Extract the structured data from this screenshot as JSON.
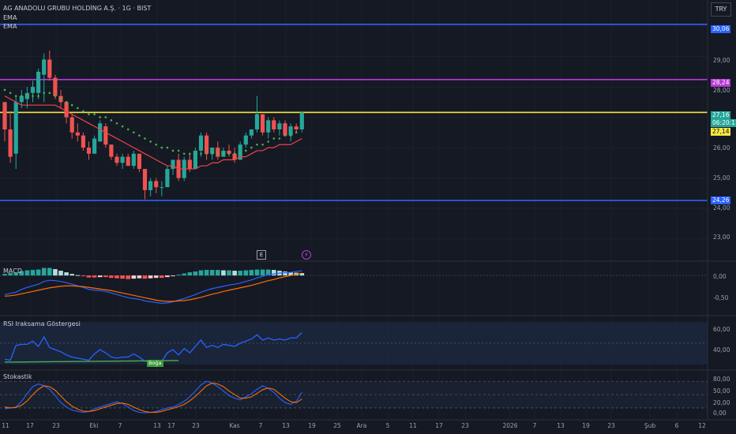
{
  "header": {
    "title": "AG ANADOLU GRUBU HOLDİNG A.Ş. · 1G · BIST",
    "indicators": [
      "EMA",
      "EMA"
    ],
    "currency": "TRY"
  },
  "price_axis": {
    "labels": [
      "30,06",
      "29,00",
      "28,24",
      "28,00",
      "27,16",
      "06:20:11",
      "27,14",
      "26,00",
      "25,00",
      "24,26",
      "24,00",
      "23,00"
    ]
  },
  "horizontal_lines": [
    {
      "price": 30.06,
      "label": "30,06",
      "color": "#2962ff"
    },
    {
      "price": 28.24,
      "label": "28,24",
      "color": "#b63ad6"
    },
    {
      "price": 27.16,
      "label": "27,16",
      "color": "#f5e642"
    },
    {
      "price": 24.26,
      "label": "24,26",
      "color": "#2962ff"
    }
  ],
  "last_price": {
    "value": "27,16",
    "countdown": "06:20:11",
    "ema": "27,14"
  },
  "event_markers": [
    "E",
    "⚡"
  ],
  "panes": {
    "macd": {
      "label": "MACD",
      "axis": [
        "0,00",
        "-0,50"
      ]
    },
    "rsi": {
      "label": "RSI Iraksama Göstergesi",
      "axis": [
        "60,00",
        "40,00"
      ],
      "badge": "Boğa"
    },
    "stoch": {
      "label": "Stokastik",
      "axis": [
        "80,00",
        "50,00",
        "20,00",
        "0,00"
      ]
    }
  },
  "time_axis": [
    "11",
    "17",
    "23",
    "Eki",
    "7",
    "13",
    "17",
    "23",
    "Kas",
    "7",
    "13",
    "19",
    "25",
    "Ara",
    "5",
    "11",
    "17",
    "23",
    "2026",
    "7",
    "13",
    "19",
    "23",
    "Şub",
    "6",
    "12"
  ],
  "chart_data": {
    "type": "candlestick",
    "ylim": [
      22.6,
      30.6
    ],
    "candles": [
      [
        27.5,
        27.5,
        26.2,
        26.6
      ],
      [
        26.6,
        27.2,
        25.5,
        25.7
      ],
      [
        25.8,
        27.7,
        25.3,
        27.5
      ],
      [
        27.5,
        27.9,
        27.3,
        27.7
      ],
      [
        27.6,
        28.0,
        27.3,
        27.8
      ],
      [
        27.8,
        28.2,
        27.5,
        28.0
      ],
      [
        27.8,
        28.6,
        27.6,
        28.5
      ],
      [
        28.4,
        29.1,
        27.5,
        28.9
      ],
      [
        28.9,
        29.2,
        28.2,
        28.3
      ],
      [
        28.3,
        28.4,
        27.6,
        27.7
      ],
      [
        27.7,
        27.9,
        27.3,
        27.5
      ],
      [
        27.5,
        27.5,
        26.8,
        27.0
      ],
      [
        27.0,
        27.1,
        26.3,
        26.5
      ],
      [
        26.5,
        26.8,
        26.2,
        26.4
      ],
      [
        26.4,
        26.5,
        25.9,
        26.0
      ],
      [
        26.0,
        26.2,
        25.6,
        25.8
      ],
      [
        25.8,
        26.4,
        25.8,
        26.3
      ],
      [
        26.2,
        26.9,
        26.2,
        26.8
      ],
      [
        26.7,
        26.8,
        26.0,
        26.1
      ],
      [
        26.1,
        26.1,
        25.6,
        25.7
      ],
      [
        25.7,
        25.8,
        25.4,
        25.5
      ],
      [
        25.5,
        25.8,
        25.3,
        25.7
      ],
      [
        25.7,
        25.8,
        25.4,
        25.4
      ],
      [
        25.4,
        25.9,
        25.3,
        25.8
      ],
      [
        25.8,
        25.8,
        25.2,
        25.3
      ],
      [
        25.3,
        25.3,
        24.3,
        24.6
      ],
      [
        24.6,
        25.0,
        24.4,
        24.9
      ],
      [
        24.9,
        25.0,
        24.5,
        24.7
      ],
      [
        24.7,
        24.9,
        24.4,
        24.7
      ],
      [
        24.7,
        25.4,
        24.7,
        25.3
      ],
      [
        25.3,
        25.6,
        25.1,
        25.6
      ],
      [
        25.6,
        25.8,
        24.9,
        25.0
      ],
      [
        25.0,
        25.7,
        24.9,
        25.6
      ],
      [
        25.6,
        25.8,
        25.2,
        25.3
      ],
      [
        25.3,
        26.0,
        25.3,
        25.9
      ],
      [
        25.9,
        26.5,
        25.7,
        26.4
      ],
      [
        26.4,
        26.5,
        25.6,
        25.8
      ],
      [
        25.8,
        26.0,
        25.6,
        26.0
      ],
      [
        26.0,
        26.2,
        25.6,
        25.7
      ],
      [
        25.7,
        26.0,
        25.7,
        25.9
      ],
      [
        25.9,
        26.1,
        25.7,
        25.8
      ],
      [
        25.8,
        26.0,
        25.5,
        25.6
      ],
      [
        25.6,
        26.2,
        25.6,
        26.1
      ],
      [
        26.1,
        26.5,
        26.0,
        26.4
      ],
      [
        26.4,
        26.6,
        26.3,
        26.6
      ],
      [
        26.6,
        27.7,
        26.5,
        27.1
      ],
      [
        27.1,
        27.1,
        26.4,
        26.5
      ],
      [
        26.5,
        27.0,
        26.3,
        26.9
      ],
      [
        26.9,
        27.0,
        26.5,
        26.6
      ],
      [
        26.6,
        26.9,
        26.4,
        26.8
      ],
      [
        26.8,
        26.9,
        26.4,
        26.4
      ],
      [
        26.4,
        26.8,
        26.2,
        26.7
      ],
      [
        26.7,
        26.8,
        26.5,
        26.6
      ],
      [
        26.6,
        27.2,
        26.5,
        27.16
      ]
    ],
    "ema_fast": [
      27.9,
      27.8,
      27.7,
      27.7,
      27.7,
      27.7,
      27.7,
      27.8,
      27.8,
      27.7,
      27.6,
      27.5,
      27.4,
      27.3,
      27.2,
      27.1,
      27.1,
      27.0,
      27.0,
      26.9,
      26.8,
      26.7,
      26.6,
      26.5,
      26.4,
      26.3,
      26.2,
      26.1,
      26.0,
      26.0,
      25.9,
      25.9,
      25.8,
      25.8,
      25.8,
      25.8,
      25.8,
      25.8,
      25.8,
      25.8,
      25.8,
      25.8,
      25.8,
      25.9,
      26.0,
      26.1,
      26.1,
      26.2,
      26.3,
      26.3,
      26.4,
      26.4,
      26.5,
      27.14
    ],
    "ema_slow": [
      27.7,
      27.6,
      27.5,
      27.4,
      27.4,
      27.4,
      27.4,
      27.4,
      27.4,
      27.4,
      27.3,
      27.2,
      27.1,
      27.0,
      26.9,
      26.8,
      26.7,
      26.6,
      26.5,
      26.4,
      26.3,
      26.2,
      26.1,
      26.0,
      25.9,
      25.8,
      25.7,
      25.6,
      25.5,
      25.4,
      25.4,
      25.3,
      25.3,
      25.3,
      25.3,
      25.4,
      25.4,
      25.5,
      25.5,
      25.6,
      25.6,
      25.6,
      25.7,
      25.7,
      25.8,
      25.9,
      25.9,
      26.0,
      26.0,
      26.1,
      26.1,
      26.1,
      26.2,
      26.3
    ],
    "macd": {
      "ylim": [
        -0.95,
        0.3
      ],
      "macd_line": [
        -0.48,
        -0.45,
        -0.42,
        -0.35,
        -0.3,
        -0.26,
        -0.22,
        -0.15,
        -0.12,
        -0.13,
        -0.15,
        -0.18,
        -0.22,
        -0.26,
        -0.3,
        -0.35,
        -0.37,
        -0.38,
        -0.4,
        -0.44,
        -0.48,
        -0.52,
        -0.56,
        -0.58,
        -0.6,
        -0.64,
        -0.66,
        -0.68,
        -0.7,
        -0.69,
        -0.66,
        -0.62,
        -0.58,
        -0.53,
        -0.48,
        -0.42,
        -0.37,
        -0.33,
        -0.3,
        -0.27,
        -0.24,
        -0.22,
        -0.19,
        -0.15,
        -0.11,
        -0.06,
        -0.02,
        0.02,
        0.04,
        0.06,
        0.07,
        0.08,
        0.1,
        0.12
      ],
      "signal_line": [
        -0.52,
        -0.51,
        -0.49,
        -0.46,
        -0.43,
        -0.4,
        -0.37,
        -0.34,
        -0.31,
        -0.29,
        -0.27,
        -0.26,
        -0.26,
        -0.27,
        -0.28,
        -0.3,
        -0.32,
        -0.34,
        -0.36,
        -0.38,
        -0.41,
        -0.44,
        -0.47,
        -0.5,
        -0.53,
        -0.56,
        -0.59,
        -0.62,
        -0.64,
        -0.65,
        -0.65,
        -0.64,
        -0.63,
        -0.61,
        -0.58,
        -0.55,
        -0.51,
        -0.47,
        -0.44,
        -0.4,
        -0.37,
        -0.34,
        -0.31,
        -0.28,
        -0.25,
        -0.21,
        -0.17,
        -0.13,
        -0.1,
        -0.06,
        -0.03,
        0.0,
        0.03,
        0.06
      ],
      "histogram": [
        0.04,
        0.06,
        0.07,
        0.11,
        0.13,
        0.14,
        0.15,
        0.19,
        0.19,
        0.16,
        0.12,
        0.08,
        0.04,
        0.01,
        -0.02,
        -0.05,
        -0.05,
        -0.04,
        -0.04,
        -0.06,
        -0.07,
        -0.08,
        -0.09,
        -0.08,
        -0.07,
        -0.08,
        -0.07,
        -0.06,
        -0.06,
        -0.04,
        -0.01,
        0.02,
        0.05,
        0.08,
        0.1,
        0.13,
        0.14,
        0.14,
        0.14,
        0.13,
        0.13,
        0.12,
        0.12,
        0.13,
        0.14,
        0.15,
        0.15,
        0.15,
        0.14,
        0.12,
        0.1,
        0.08,
        0.07,
        0.06
      ]
    },
    "rsi": {
      "ylim": [
        27,
        73
      ],
      "values": [
        35,
        34,
        48,
        49,
        49,
        52,
        47,
        56,
        46,
        44,
        42,
        39,
        37,
        36,
        35,
        34,
        40,
        44,
        41,
        37,
        36,
        37,
        37,
        40,
        37,
        33,
        34,
        33,
        33,
        41,
        44,
        39,
        45,
        41,
        47,
        53,
        46,
        48,
        46,
        49,
        48,
        47,
        50,
        52,
        54,
        58,
        53,
        55,
        53,
        54,
        53,
        55,
        55,
        60
      ],
      "divergence": {
        "from": 0,
        "to": 31,
        "y_from": 33,
        "y_to": 33
      }
    },
    "stoch": {
      "ylim": [
        -5,
        100
      ],
      "k": [
        18,
        20,
        22,
        35,
        52,
        68,
        74,
        70,
        62,
        48,
        32,
        22,
        15,
        12,
        10,
        12,
        18,
        22,
        26,
        30,
        34,
        30,
        22,
        14,
        10,
        9,
        10,
        12,
        16,
        20,
        22,
        28,
        35,
        45,
        58,
        72,
        80,
        76,
        68,
        58,
        48,
        42,
        38,
        45,
        52,
        62,
        70,
        64,
        55,
        42,
        32,
        28,
        35,
        55
      ],
      "d": [
        22,
        20,
        21,
        26,
        36,
        50,
        62,
        70,
        68,
        60,
        47,
        34,
        24,
        17,
        13,
        12,
        14,
        18,
        22,
        26,
        30,
        31,
        28,
        22,
        16,
        12,
        10,
        10,
        12,
        16,
        19,
        23,
        28,
        36,
        46,
        58,
        70,
        76,
        74,
        68,
        58,
        50,
        42,
        42,
        45,
        53,
        61,
        65,
        62,
        52,
        42,
        34,
        32,
        40
      ]
    }
  }
}
